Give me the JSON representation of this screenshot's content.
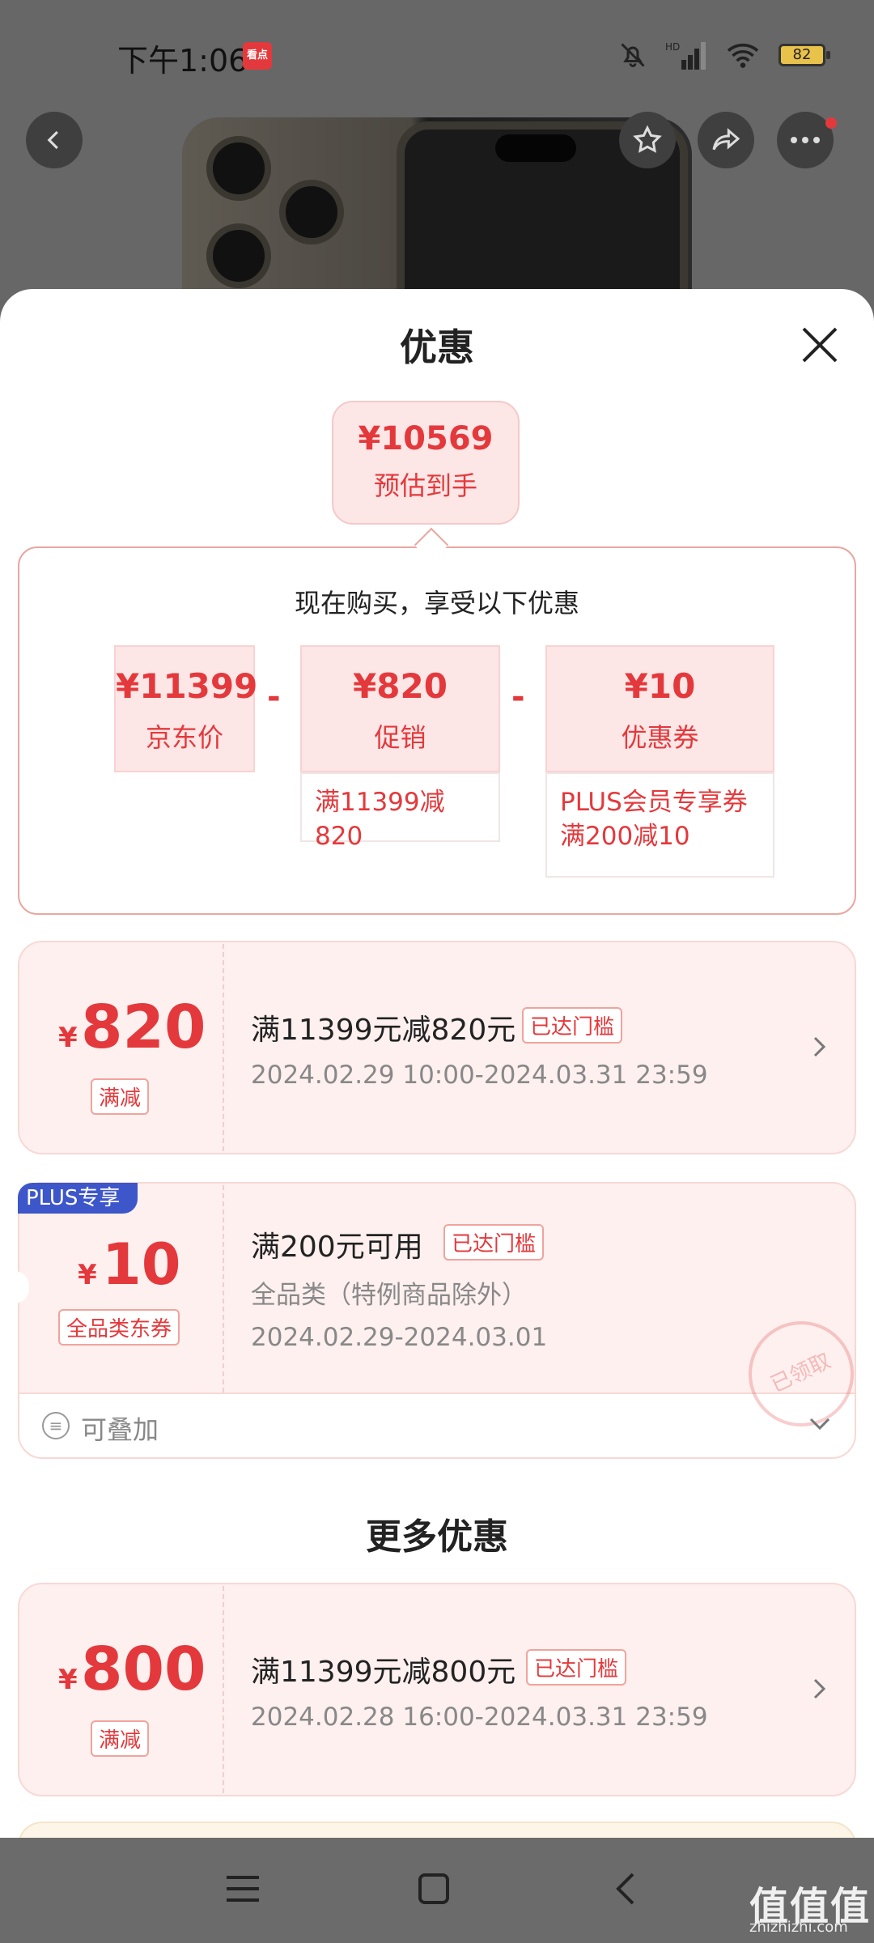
{
  "status_bar": {
    "time": "下午1:06",
    "app_badge": "看点",
    "battery": "82"
  },
  "colors": {
    "accent": "#e4393c",
    "plus_blue": "#3d56c9",
    "card_bg": "#fdf0ef"
  },
  "sheet": {
    "title": "优惠",
    "estimate": {
      "price": "¥10569",
      "label": "预估到手"
    },
    "summary_heading": "现在购买，享受以下优惠",
    "breakdown": [
      {
        "value": "¥11399",
        "name": "京东价"
      },
      {
        "value": "¥820",
        "name": "促销",
        "condition": "满11399减820"
      },
      {
        "value": "¥10",
        "name": "优惠券",
        "condition_line1": "PLUS会员专享券",
        "condition_line2": "满200减10"
      }
    ],
    "minus": "-"
  },
  "promos": [
    {
      "currency": "¥",
      "amount": "820",
      "type": "满减",
      "title": "满11399元减820元",
      "tag": "已达门槛",
      "period": "2024.02.29 10:00-2024.03.31 23:59"
    },
    {
      "badge": "PLUS专享",
      "currency": "¥",
      "amount": "10",
      "type": "全品类东券",
      "title": "满200元可用",
      "tag": "已达门槛",
      "scope": "全品类（特例商品除外）",
      "period": "2024.02.29-2024.03.01",
      "stamp": "已领取",
      "stackable": "可叠加"
    }
  ],
  "more": {
    "title": "更多优惠",
    "items": [
      {
        "currency": "¥",
        "amount": "800",
        "type": "满减",
        "title": "满11399元减800元",
        "tag": "已达门槛",
        "period": "2024.02.28 16:00-2024.03.31 23:59"
      }
    ]
  },
  "watermark": {
    "main": "值值值",
    "sub": "zhizhizhi.com"
  }
}
